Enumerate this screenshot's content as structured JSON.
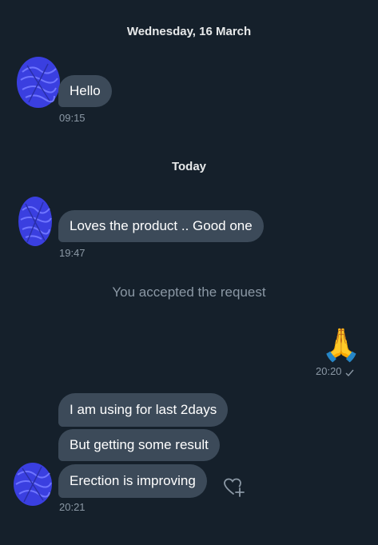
{
  "conversation": {
    "separators": [
      {
        "label": "Wednesday, 16 March"
      },
      {
        "label": "Today"
      }
    ],
    "messages": [
      {
        "text": "Hello",
        "time": "09:15"
      },
      {
        "text": "Loves the product .. Good one",
        "time": "19:47"
      },
      {
        "emoji": "🙏",
        "time": "20:20",
        "status_icon": "check-icon"
      },
      {
        "text": "I am using for last 2days"
      },
      {
        "text": "But getting some result"
      },
      {
        "text": "Erection is improving",
        "time": "20:21"
      }
    ],
    "system_notice": "You accepted the request"
  },
  "colors": {
    "background": "#15202b",
    "bubble_incoming": "#3c4a59",
    "muted_text": "#8b98a5",
    "avatar_scribble": "#3a3fe0"
  },
  "icons": {
    "react": "heart-plus-icon",
    "read_status": "check-icon"
  }
}
